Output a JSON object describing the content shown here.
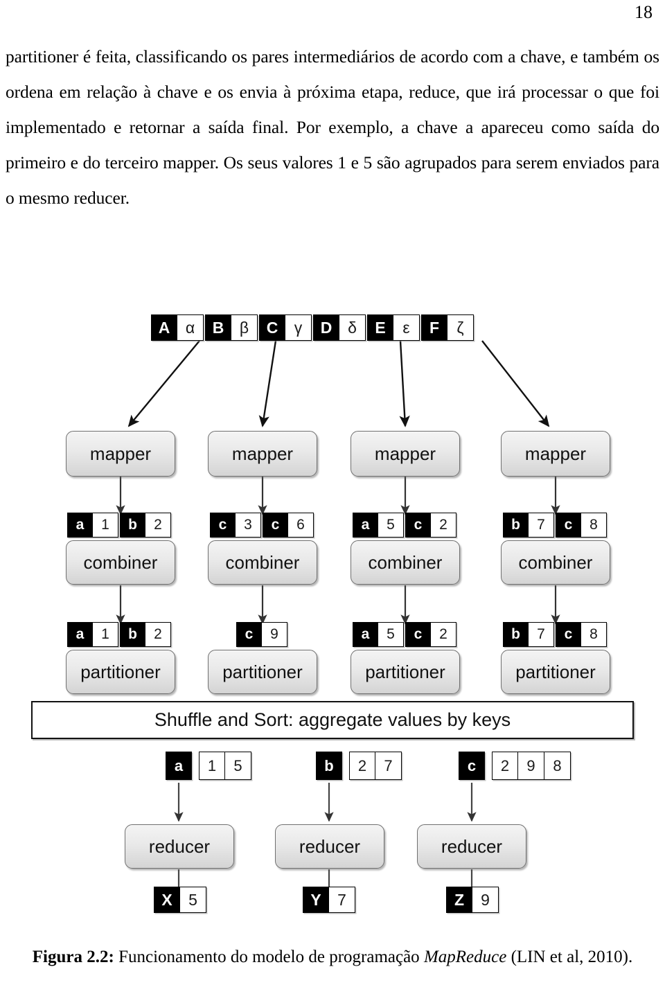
{
  "page": {
    "number": "18"
  },
  "body": {
    "paragraph": "partitioner é feita, classificando os pares intermediários de acordo com a chave, e também os ordena em relação à chave e os envia à próxima etapa, reduce, que irá processar o que foi implementado e retornar a saída final. Por exemplo, a chave a apareceu como saída do primeiro e do terceiro mapper. Os seus valores 1 e 5 são agrupados para serem enviados para o mesmo reducer."
  },
  "figure": {
    "caption_label": "Figura 2.2:",
    "caption_text_1": "Funcionamento do modelo de programação",
    "caption_italic": "MapReduce",
    "caption_text_2": "(LIN et al,",
    "caption_text_3": "2010).",
    "shuffle_bar_label": "Shuffle and Sort: aggregate values by keys",
    "input_pairs": [
      {
        "key": "A",
        "value": "α"
      },
      {
        "key": "B",
        "value": "β"
      },
      {
        "key": "C",
        "value": "γ"
      },
      {
        "key": "D",
        "value": "δ"
      },
      {
        "key": "E",
        "value": "ε"
      },
      {
        "key": "F",
        "value": "ζ"
      }
    ],
    "mapper_label": "mapper",
    "combiner_label": "combiner",
    "partitioner_label": "partitioner",
    "reducer_label": "reducer",
    "mappers": [
      {
        "label": "mapper"
      },
      {
        "label": "mapper"
      },
      {
        "label": "mapper"
      },
      {
        "label": "mapper"
      }
    ],
    "mapper_outputs": [
      [
        {
          "key": "a",
          "value": "1"
        },
        {
          "key": "b",
          "value": "2"
        }
      ],
      [
        {
          "key": "c",
          "value": "3"
        },
        {
          "key": "c",
          "value": "6"
        }
      ],
      [
        {
          "key": "a",
          "value": "5"
        },
        {
          "key": "c",
          "value": "2"
        }
      ],
      [
        {
          "key": "b",
          "value": "7"
        },
        {
          "key": "c",
          "value": "8"
        }
      ]
    ],
    "combiners": [
      {
        "label": "combiner"
      },
      {
        "label": "combiner"
      },
      {
        "label": "combiner"
      },
      {
        "label": "combiner"
      }
    ],
    "combiner_outputs": [
      [
        {
          "key": "a",
          "value": "1"
        },
        {
          "key": "b",
          "value": "2"
        }
      ],
      [
        {
          "key": "c",
          "value": "9"
        }
      ],
      [
        {
          "key": "a",
          "value": "5"
        },
        {
          "key": "c",
          "value": "2"
        }
      ],
      [
        {
          "key": "b",
          "value": "7"
        },
        {
          "key": "c",
          "value": "8"
        }
      ]
    ],
    "partitioners": [
      {
        "label": "partitioner"
      },
      {
        "label": "partitioner"
      },
      {
        "label": "partitioner"
      },
      {
        "label": "partitioner"
      }
    ],
    "aggregated": [
      {
        "key": "a",
        "values": [
          "1",
          "5"
        ]
      },
      {
        "key": "b",
        "values": [
          "2",
          "7"
        ]
      },
      {
        "key": "c",
        "values": [
          "2",
          "9",
          "8"
        ]
      }
    ],
    "reducers": [
      {
        "label": "reducer"
      },
      {
        "label": "reducer"
      },
      {
        "label": "reducer"
      }
    ],
    "final_outputs": [
      {
        "key": "X",
        "value": "5"
      },
      {
        "key": "Y",
        "value": "7"
      },
      {
        "key": "Z",
        "value": "9"
      }
    ]
  },
  "colors": {
    "key_bg": "#000000",
    "key_fg": "#ffffff",
    "value_bg": "#ffffff",
    "value_fg": "#1a1a1a",
    "box_border": "#6f6f6f",
    "page_bg": "#ffffff"
  }
}
